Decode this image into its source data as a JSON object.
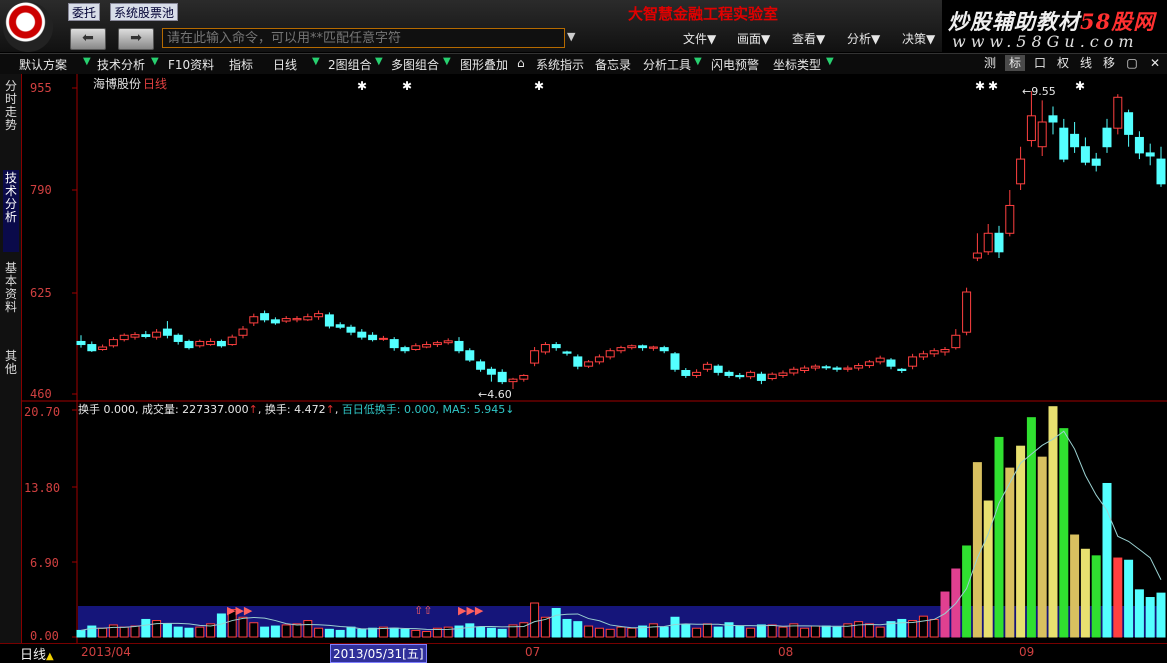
{
  "topbar": {
    "weituo_label": "委托",
    "stock_pool_label": "系统股票池",
    "back_glyph": "⬅",
    "forward_glyph": "➡",
    "command_placeholder": "请在此输入命令，可以用**匹配任意字符",
    "app_title": "大智慧金融工程实验室",
    "menus": [
      "文件▼",
      "画面▼",
      "查看▼",
      "分析▼",
      "决策▼"
    ],
    "brand_text_a": "炒股辅助教材",
    "brand_text_b": "58股网",
    "brand_url": "www.58Gu.com"
  },
  "toolbar": {
    "items": [
      "默认方案",
      "技术分析",
      "F10资料",
      "指标",
      "日线",
      "2图组合",
      "多图组合",
      "图形叠加",
      "系统指示",
      "备忘录",
      "分析工具",
      "闪电预警",
      "坐标类型"
    ],
    "right_items": [
      "测",
      "标",
      "口",
      "权",
      "线",
      "移",
      "▢",
      "✕"
    ]
  },
  "left_tabs": [
    "分时走势",
    "技术分析",
    "基本资料",
    "其他"
  ],
  "chart": {
    "stock_name": "海博股份",
    "period": "日线",
    "price_axis": [
      "955",
      "790",
      "625",
      "460"
    ],
    "volume_axis": [
      "20.70",
      "13.80",
      "6.90",
      "0.00"
    ],
    "high_marker": "9.55",
    "low_marker": "4.60",
    "volume_info": {
      "a": "换手 0.000, 成交量: 227337.000",
      "b": "换手: 4.472",
      "c": "百日低换手: 0.000, MA5: 5.945"
    }
  },
  "bottombar": {
    "period_label": "日线",
    "dates": [
      "2013/04",
      "07",
      "08",
      "09"
    ],
    "cursor_date": "2013/05/31[五]"
  },
  "chart_data": {
    "type": "candlestick",
    "ylim_price": [
      460,
      955
    ],
    "ylim_turnover": [
      0,
      20.7
    ],
    "candles": [
      [
        545,
        540,
        555,
        535
      ],
      [
        540,
        530,
        545,
        528
      ],
      [
        532,
        536,
        540,
        530
      ],
      [
        538,
        548,
        552,
        535
      ],
      [
        548,
        555,
        558,
        545
      ],
      [
        552,
        556,
        560,
        548
      ],
      [
        556,
        553,
        562,
        550
      ],
      [
        552,
        560,
        565,
        548
      ],
      [
        565,
        555,
        578,
        550
      ],
      [
        555,
        545,
        558,
        540
      ],
      [
        545,
        535,
        548,
        532
      ],
      [
        538,
        545,
        548,
        535
      ],
      [
        540,
        545,
        550,
        538
      ],
      [
        545,
        538,
        548,
        535
      ],
      [
        540,
        552,
        556,
        538
      ],
      [
        555,
        565,
        570,
        550
      ],
      [
        575,
        585,
        590,
        570
      ],
      [
        590,
        580,
        595,
        576
      ],
      [
        580,
        575,
        584,
        572
      ],
      [
        578,
        582,
        586,
        575
      ],
      [
        580,
        582,
        586,
        576
      ],
      [
        580,
        585,
        590,
        578
      ],
      [
        585,
        590,
        595,
        580
      ],
      [
        588,
        570,
        592,
        566
      ],
      [
        572,
        568,
        576,
        565
      ],
      [
        568,
        560,
        572,
        555
      ],
      [
        560,
        552,
        565,
        548
      ],
      [
        555,
        548,
        560,
        545
      ],
      [
        550,
        550,
        554,
        546
      ],
      [
        548,
        535,
        552,
        530
      ],
      [
        535,
        530,
        538,
        526
      ],
      [
        532,
        538,
        542,
        530
      ],
      [
        536,
        540,
        545,
        534
      ],
      [
        540,
        543,
        546,
        536
      ],
      [
        543,
        546,
        550,
        540
      ],
      [
        545,
        530,
        552,
        526
      ],
      [
        530,
        515,
        534,
        512
      ],
      [
        512,
        500,
        516,
        496
      ],
      [
        500,
        492,
        504,
        480
      ],
      [
        495,
        480,
        500,
        476
      ],
      [
        480,
        484,
        486,
        468
      ],
      [
        484,
        490,
        492,
        480
      ],
      [
        510,
        530,
        536,
        505
      ],
      [
        528,
        540,
        544,
        524
      ],
      [
        540,
        535,
        544,
        530
      ],
      [
        528,
        526,
        530,
        522
      ],
      [
        520,
        505,
        524,
        500
      ],
      [
        505,
        512,
        515,
        502
      ],
      [
        512,
        520,
        524,
        508
      ],
      [
        520,
        530,
        534,
        516
      ],
      [
        530,
        535,
        538,
        526
      ],
      [
        535,
        538,
        540,
        532
      ],
      [
        538,
        535,
        540,
        530
      ],
      [
        534,
        536,
        538,
        530
      ],
      [
        535,
        530,
        538,
        526
      ],
      [
        525,
        500,
        528,
        496
      ],
      [
        498,
        490,
        502,
        486
      ],
      [
        490,
        495,
        500,
        486
      ],
      [
        500,
        508,
        512,
        496
      ],
      [
        505,
        495,
        508,
        490
      ],
      [
        495,
        490,
        498,
        486
      ],
      [
        490,
        488,
        494,
        484
      ],
      [
        488,
        495,
        498,
        484
      ],
      [
        492,
        482,
        496,
        476
      ],
      [
        485,
        492,
        495,
        482
      ],
      [
        490,
        494,
        498,
        486
      ],
      [
        494,
        500,
        504,
        490
      ],
      [
        498,
        502,
        506,
        494
      ],
      [
        502,
        505,
        508,
        498
      ],
      [
        504,
        503,
        507,
        499
      ],
      [
        502,
        500,
        505,
        496
      ],
      [
        500,
        502,
        506,
        496
      ],
      [
        502,
        506,
        510,
        498
      ],
      [
        506,
        512,
        515,
        502
      ],
      [
        512,
        518,
        522,
        508
      ],
      [
        515,
        505,
        518,
        500
      ],
      [
        500,
        498,
        502,
        494
      ],
      [
        505,
        520,
        525,
        500
      ],
      [
        520,
        525,
        530,
        515
      ],
      [
        525,
        530,
        534,
        520
      ],
      [
        528,
        532,
        536,
        522
      ],
      [
        535,
        555,
        565,
        532
      ],
      [
        560,
        625,
        632,
        555
      ],
      [
        680,
        688,
        720,
        675
      ],
      [
        690,
        720,
        735,
        685
      ],
      [
        720,
        690,
        732,
        680
      ],
      [
        720,
        765,
        790,
        715
      ],
      [
        800,
        840,
        860,
        790
      ],
      [
        870,
        910,
        950,
        860
      ],
      [
        860,
        900,
        935,
        845
      ],
      [
        910,
        900,
        925,
        880
      ],
      [
        890,
        840,
        905,
        835
      ],
      [
        880,
        860,
        900,
        850
      ],
      [
        860,
        835,
        875,
        830
      ],
      [
        840,
        830,
        850,
        820
      ],
      [
        890,
        860,
        905,
        850
      ],
      [
        890,
        940,
        945,
        880
      ],
      [
        915,
        880,
        920,
        860
      ],
      [
        875,
        850,
        885,
        840
      ],
      [
        850,
        845,
        865,
        830
      ],
      [
        840,
        800,
        860,
        795
      ],
      [
        815,
        805,
        840,
        790
      ]
    ],
    "turnover_bars": [
      0.6,
      1.0,
      0.8,
      1.1,
      0.9,
      1.0,
      1.6,
      1.5,
      1.2,
      0.9,
      0.8,
      0.9,
      1.2,
      2.1,
      2.5,
      1.8,
      1.3,
      0.9,
      1.0,
      1.1,
      1.2,
      1.5,
      0.8,
      0.7,
      0.6,
      0.9,
      0.7,
      0.8,
      0.9,
      0.8,
      0.7,
      0.6,
      0.5,
      0.8,
      0.9,
      1.0,
      1.2,
      0.9,
      0.8,
      0.7,
      1.1,
      1.3,
      3.1,
      1.8,
      2.6,
      1.6,
      1.4,
      1.0,
      0.8,
      0.7,
      0.9,
      0.8,
      1.0,
      1.2,
      0.9,
      1.8,
      1.1,
      0.8,
      1.2,
      0.9,
      1.3,
      1.0,
      0.8,
      1.1,
      1.1,
      0.9,
      1.2,
      0.8,
      1.0,
      1.0,
      0.9,
      1.2,
      1.4,
      1.2,
      0.9,
      1.4,
      1.6,
      1.5,
      1.9,
      1.6,
      4.1,
      6.2,
      8.3,
      15.9,
      12.4,
      18.2,
      15.4,
      17.4,
      20.0,
      16.4,
      21.0,
      19.0,
      9.3,
      8.0,
      7.4,
      14.0,
      7.2,
      7.0,
      4.3,
      3.6,
      4.0
    ],
    "turnover_ma_line": true
  }
}
